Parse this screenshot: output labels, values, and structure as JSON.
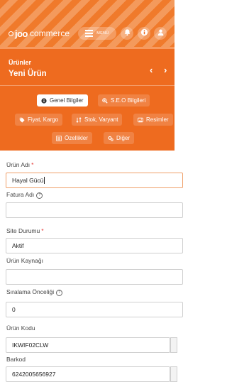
{
  "header": {
    "logo_prefix": "joo",
    "logo_suffix": "commerce",
    "menu_label": "MENÜ",
    "colors": {
      "accent": "#f07a2b",
      "panel": "#ee6b1f"
    }
  },
  "panel": {
    "breadcrumb": "Ürünler",
    "title": "Yeni Ürün",
    "prev_arrow": "‹",
    "next_arrow": "›",
    "tabs": [
      {
        "label": "Genel Bilgiler",
        "icon": "info-circle-icon",
        "active": true
      },
      {
        "label": "S.E.O Bilgileri",
        "icon": "search-plus-icon",
        "active": false
      },
      {
        "label": "Fiyat, Kargo",
        "icon": "tag-icon",
        "active": false
      },
      {
        "label": "Stok, Varyant",
        "icon": "sort-icon",
        "active": false
      },
      {
        "label": "Resimler",
        "icon": "image-icon",
        "active": false
      },
      {
        "label": "Özellikler",
        "icon": "list-icon",
        "active": false
      },
      {
        "label": "Diğer",
        "icon": "gears-icon",
        "active": false
      }
    ]
  },
  "form": {
    "fields": [
      {
        "label": "Ürün Adı",
        "required": "*",
        "value": "Hayal Gücü"
      },
      {
        "label": "Fatura Adı",
        "help": "?",
        "value": ""
      },
      {
        "label": "Site Durumu",
        "required": "*",
        "value": "Aktif"
      },
      {
        "label": "Ürün Kaynağı",
        "value": ""
      },
      {
        "label": "Sıralama Önceliği",
        "help": "?",
        "value": "0"
      },
      {
        "label": "Ürün Kodu",
        "value": "IKWIF02CLW"
      },
      {
        "label": "Barkod",
        "value": "6242005656927"
      }
    ]
  }
}
